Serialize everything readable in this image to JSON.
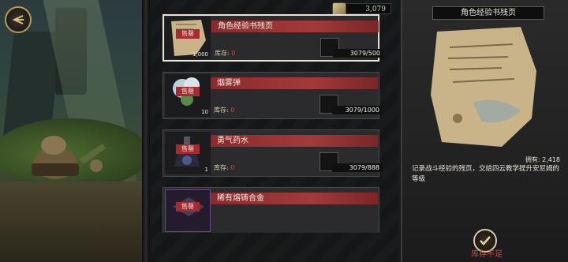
{
  "header": {
    "currency_value": "3,079"
  },
  "items": [
    {
      "name": "角色经验书残页",
      "sold_label": "售罄",
      "thumb_qty": "1,000",
      "stock_label": "库存:",
      "stock_value": "0",
      "cost": "3079/500",
      "selected": true
    },
    {
      "name": "烟雾弹",
      "sold_label": "售罄",
      "thumb_qty": "10",
      "stock_label": "库存:",
      "stock_value": "0",
      "cost": "3079/1000",
      "selected": false
    },
    {
      "name": "勇气药水",
      "sold_label": "售罄",
      "thumb_qty": "1",
      "stock_label": "库存:",
      "stock_value": "0",
      "cost": "3079/888",
      "selected": false
    },
    {
      "name": "稀有熔铸合金",
      "sold_label": "售罄",
      "thumb_qty": "",
      "stock_label": "",
      "stock_value": "",
      "cost": "",
      "selected": false
    }
  ],
  "detail": {
    "title": "角色经验书残页",
    "owned": "拥有: 2,418",
    "description": "记录战斗经验的残页，交给四云教学提升安尼姆的等级"
  },
  "footer": {
    "status": "库存不足"
  },
  "colors": {
    "accent_red": "#a33a3a",
    "warning": "#d8473f"
  },
  "icons": {
    "back": "back-arrow-icon",
    "confirm": "check-icon",
    "coin": "coin-icon"
  }
}
